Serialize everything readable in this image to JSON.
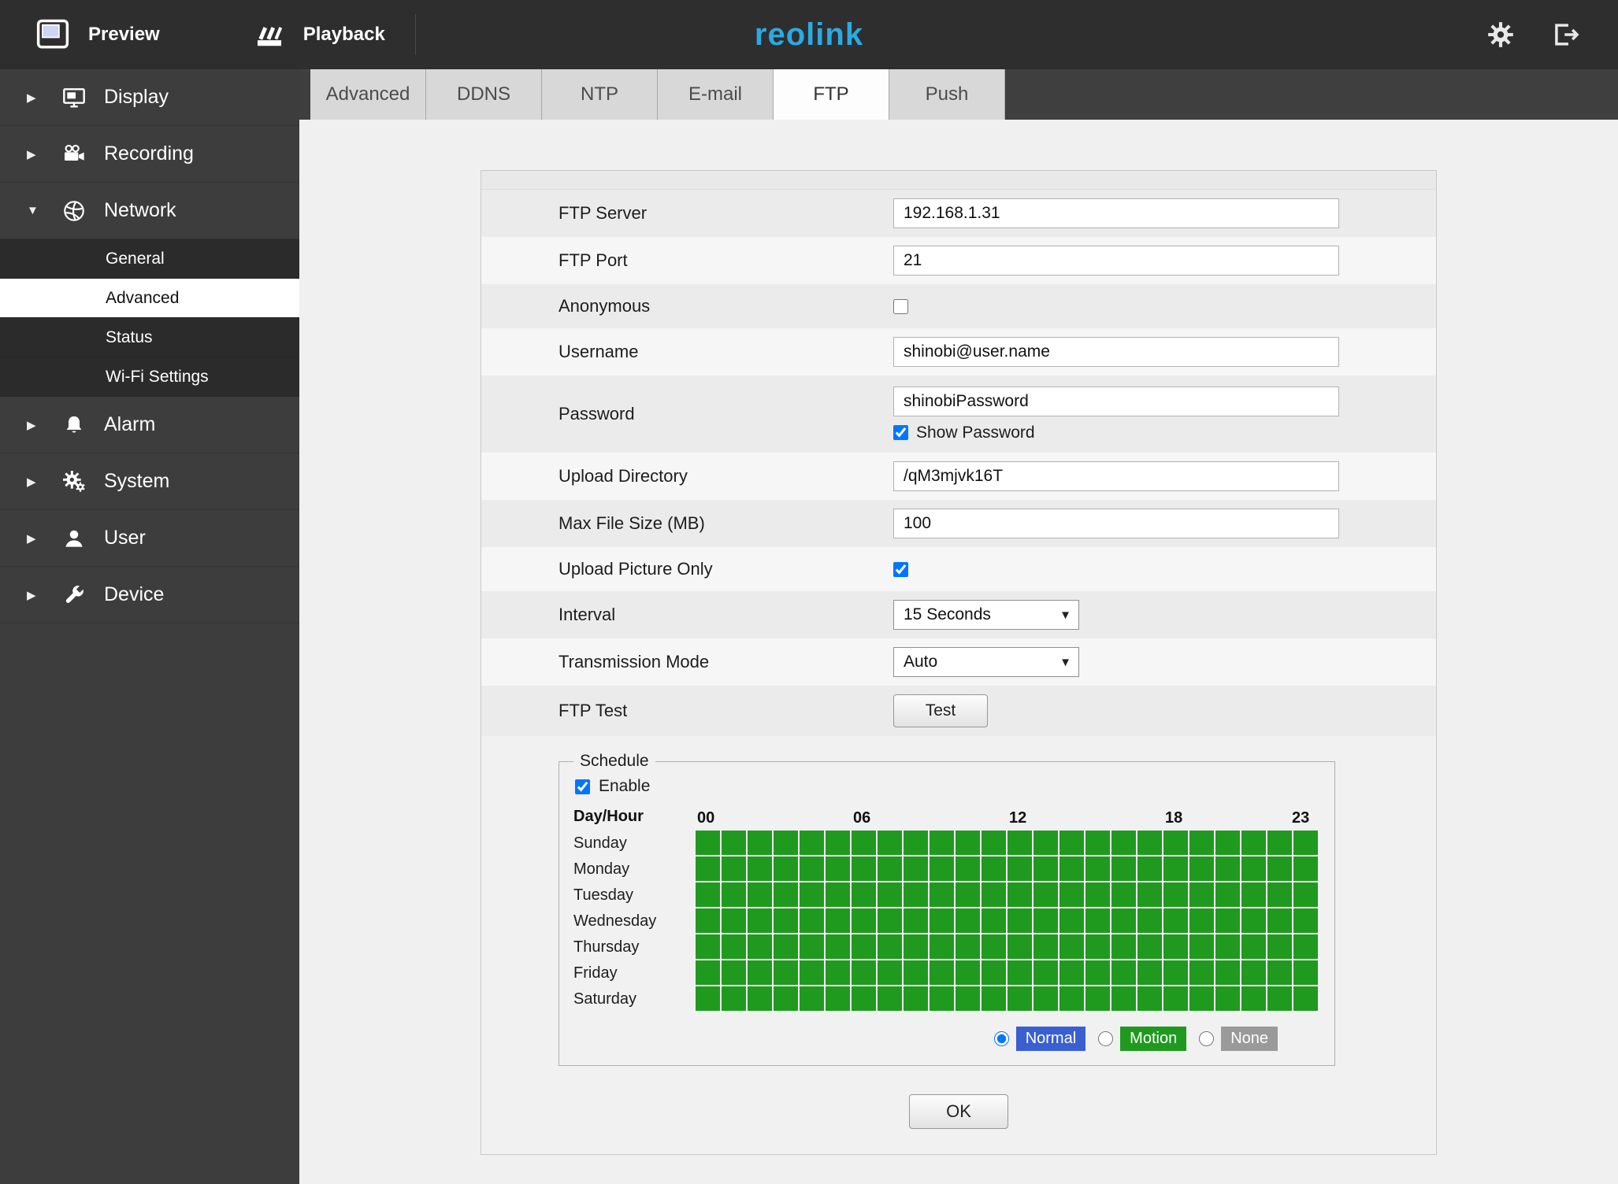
{
  "colors": {
    "topbar_bg": "#2e2e2e",
    "sidebar_bg": "#3d3d3d",
    "accent_logo": "#2aaae2",
    "motion_green": "#1f9a1f",
    "normal_blue": "#3a5fd1",
    "none_gray": "#9a9a9a"
  },
  "icons": {
    "collapsed_arrow": "▶",
    "expanded_arrow": "▼",
    "select_arrow": "▼"
  },
  "topbar": {
    "preview_label": "Preview",
    "playback_label": "Playback",
    "logo": "reolink"
  },
  "sidebar": {
    "items": [
      {
        "label": "Display"
      },
      {
        "label": "Recording"
      },
      {
        "label": "Network"
      },
      {
        "label": "Alarm"
      },
      {
        "label": "System"
      },
      {
        "label": "User"
      },
      {
        "label": "Device"
      }
    ],
    "network_children": [
      {
        "label": "General",
        "selected": false
      },
      {
        "label": "Advanced",
        "selected": true
      },
      {
        "label": "Status",
        "selected": false
      },
      {
        "label": "Wi-Fi Settings",
        "selected": false
      }
    ]
  },
  "tabs": {
    "items": [
      {
        "label": "Advanced",
        "active": false
      },
      {
        "label": "DDNS",
        "active": false
      },
      {
        "label": "NTP",
        "active": false
      },
      {
        "label": "E-mail",
        "active": false
      },
      {
        "label": "FTP",
        "active": true
      },
      {
        "label": "Push",
        "active": false
      }
    ]
  },
  "form": {
    "ftp_server": {
      "label": "FTP Server",
      "value": "192.168.1.31"
    },
    "ftp_port": {
      "label": "FTP Port",
      "value": "21"
    },
    "anonymous": {
      "label": "Anonymous",
      "checked": false
    },
    "username": {
      "label": "Username",
      "value": "shinobi@user.name"
    },
    "password": {
      "label": "Password",
      "value": "shinobiPassword",
      "show_password_label": "Show Password",
      "show_password_checked": true
    },
    "upload_directory": {
      "label": "Upload Directory",
      "value": "/qM3mjvk16T"
    },
    "max_file_size": {
      "label": "Max File Size (MB)",
      "value": "100"
    },
    "upload_picture_only": {
      "label": "Upload Picture Only",
      "checked": true
    },
    "interval": {
      "label": "Interval",
      "value": "15 Seconds"
    },
    "transmission_mode": {
      "label": "Transmission Mode",
      "value": "Auto"
    },
    "ftp_test": {
      "label": "FTP Test",
      "button_label": "Test"
    }
  },
  "schedule": {
    "legend": "Schedule",
    "enable_label": "Enable",
    "enable_checked": true,
    "day_hour_label": "Day/Hour",
    "hour_labels": [
      "00",
      "06",
      "12",
      "18",
      "23"
    ],
    "days": [
      "Sunday",
      "Monday",
      "Tuesday",
      "Wednesday",
      "Thursday",
      "Friday",
      "Saturday"
    ],
    "grid": {
      "rows": 7,
      "cols": 24,
      "all_state": "motion"
    },
    "modes": [
      {
        "label": "Normal",
        "selected": true
      },
      {
        "label": "Motion",
        "selected": false
      },
      {
        "label": "None",
        "selected": false
      }
    ]
  },
  "ok_label": "OK"
}
